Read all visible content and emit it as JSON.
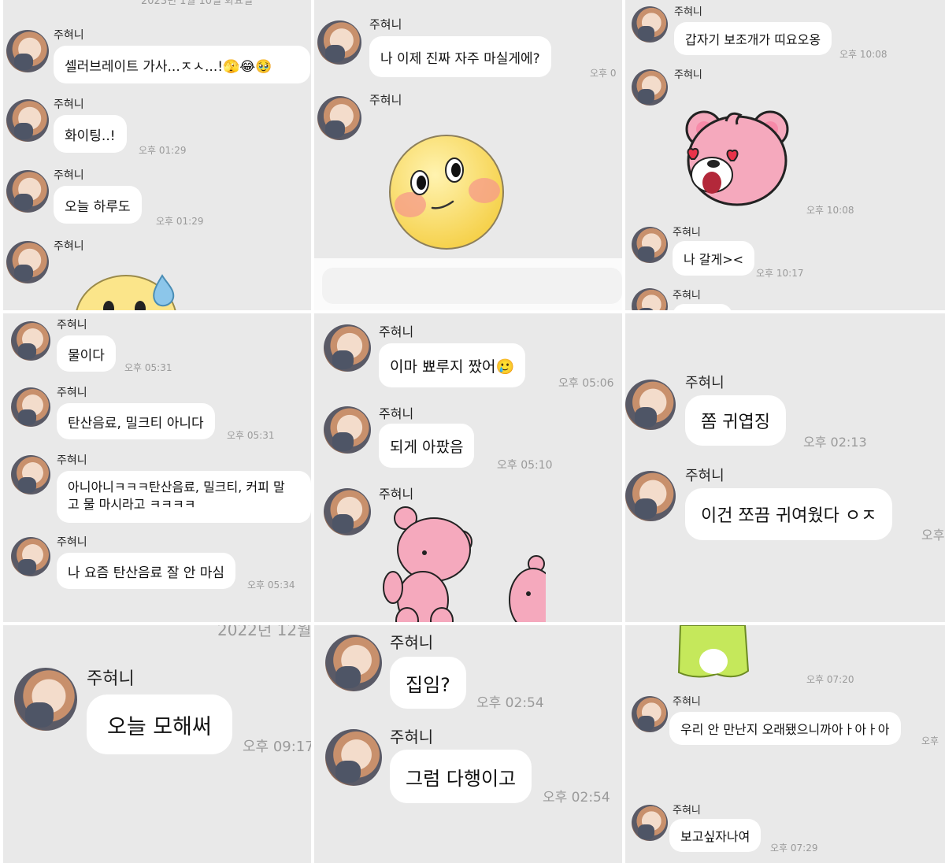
{
  "sender_name": "주혀니",
  "panels": [
    {
      "date_fragment": "2023년 1월 10일 화요일",
      "messages": [
        {
          "text": "셀러브레이트 가사...ㅈㅅ...!🫣😂🥹",
          "time": ""
        },
        {
          "text": "화이팅..!",
          "time": "오후 01:29"
        },
        {
          "text": "오늘 하루도",
          "time": "오후 01:29"
        },
        {
          "sticker": "sweating-emoji-sticker"
        }
      ]
    },
    {
      "messages": [
        {
          "text": "나 이제 진짜 자주 마실게에?",
          "time": "오후 0"
        },
        {
          "sticker": "blushing-emoji-sticker"
        }
      ]
    },
    {
      "messages": [
        {
          "text": "갑자기 보조개가 띠요오옹",
          "time": "오후 10:08"
        },
        {
          "sticker": "pink-bear-heart-eyes-sticker",
          "time": "오후 10:08"
        },
        {
          "text": "나 갈게><",
          "time": "오후 10:17"
        }
      ]
    },
    {
      "messages": [
        {
          "text": "물이다",
          "time": "오후 05:31"
        },
        {
          "text": "탄산음료, 밀크티 아니다",
          "time": "오후 05:31"
        },
        {
          "text_line1": "아니아니ㅋㅋㅋ탄산음료, 밀크티, 커피 말",
          "text_line2": "고 물 마시라고 ㅋㅋㅋㅋ",
          "time": ""
        },
        {
          "text": "나 요즘 탄산음료 잘 안 마심",
          "time": "오후 05:34"
        }
      ]
    },
    {
      "messages": [
        {
          "text": "이마 뾰루지 짰어🥲",
          "time": "오후 05:06"
        },
        {
          "text": "되게 아팠음",
          "time": "오후 05:10"
        },
        {
          "sticker": "pink-bear-walking-sticker"
        }
      ]
    },
    {
      "messages": [
        {
          "text": "쫌 귀엽징",
          "time": "오후 02:13"
        },
        {
          "text": "이건 쪼끔 귀여웠다 ㅇㅈ",
          "time": "오후"
        }
      ]
    },
    {
      "date_fragment": "2022년 12월",
      "messages": [
        {
          "text": "오늘 모해써",
          "time": "오후 09:17"
        }
      ]
    },
    {
      "messages": [
        {
          "text": "집임?",
          "time": "오후 02:54"
        },
        {
          "text": "그럼 다행이고",
          "time": "오후 02:54"
        }
      ]
    },
    {
      "messages": [
        {
          "sticker": "green-frog-sticker",
          "time": "오후 07:20"
        },
        {
          "text": "우리 안 만난지 오래됐으니까아ㅏ아ㅏ아",
          "time": "오후"
        },
        {
          "text": "보고싶자나여",
          "time": "오후 07:29"
        }
      ]
    }
  ],
  "colors": {
    "background": "#e9e9e9",
    "bubble": "#ffffff",
    "time": "#9a9a9a",
    "bear": "#f5a9bd"
  }
}
